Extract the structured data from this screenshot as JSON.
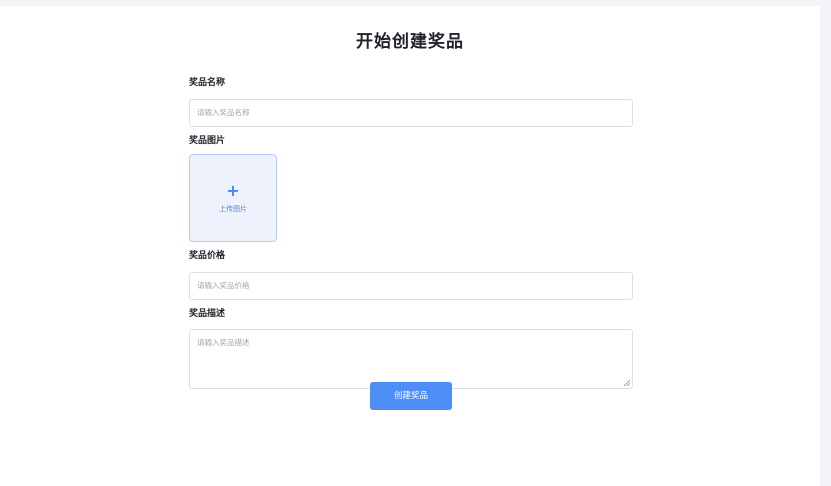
{
  "page": {
    "title": "开始创建奖品"
  },
  "form": {
    "name": {
      "label": "奖品名称",
      "placeholder": "请输入奖品名称"
    },
    "image": {
      "label": "奖品图片",
      "upload_icon": "plus-icon",
      "upload_text": "上传图片"
    },
    "price": {
      "label": "奖品价格",
      "placeholder": "请输入奖品价格"
    },
    "description": {
      "label": "奖品描述",
      "placeholder": "请输入奖品描述"
    },
    "submit_label": "创建奖品"
  },
  "colors": {
    "accent": "#4e8ff7",
    "upload_bg": "#edf2fd",
    "border": "#dcdfe6"
  }
}
